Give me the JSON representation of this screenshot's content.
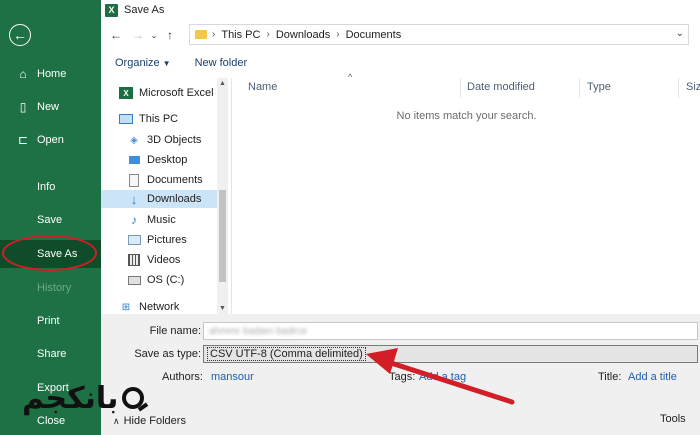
{
  "sidebar": {
    "items": [
      {
        "label": "Home",
        "icon": "home-icon",
        "glyph": "⌂"
      },
      {
        "label": "New",
        "icon": "new-document-icon",
        "glyph": "🗋"
      },
      {
        "label": "Open",
        "icon": "open-folder-icon",
        "glyph": "🗁"
      },
      {
        "label": "Info"
      },
      {
        "label": "Save"
      },
      {
        "label": "Save As"
      },
      {
        "label": "History"
      },
      {
        "label": "Print"
      },
      {
        "label": "Share"
      },
      {
        "label": "Export"
      },
      {
        "label": "Close"
      }
    ],
    "active": "Save As",
    "logo_text": "بانکجم"
  },
  "dialog": {
    "title": "Save As",
    "title_icon": "excel-icon",
    "address": {
      "crumbs": [
        "This PC",
        "Downloads",
        "Documents"
      ]
    },
    "toolbar": {
      "organize": "Organize",
      "new_folder": "New folder"
    },
    "nav_tree": [
      {
        "label": "Microsoft Excel",
        "icon": "excel-icon"
      },
      {
        "label": "This PC",
        "icon": "computer-icon"
      },
      {
        "label": "3D Objects",
        "icon": "3d-objects-icon"
      },
      {
        "label": "Desktop",
        "icon": "desktop-icon"
      },
      {
        "label": "Documents",
        "icon": "documents-icon"
      },
      {
        "label": "Downloads",
        "icon": "downloads-icon"
      },
      {
        "label": "Music",
        "icon": "music-icon"
      },
      {
        "label": "Pictures",
        "icon": "pictures-icon"
      },
      {
        "label": "Videos",
        "icon": "videos-icon"
      },
      {
        "label": "OS (C:)",
        "icon": "drive-icon"
      },
      {
        "label": "Network",
        "icon": "network-icon"
      }
    ],
    "selected_tree_item": "Downloads",
    "columns": [
      "Name",
      "Date modified",
      "Type",
      "Size"
    ],
    "empty_message": "No items match your search.",
    "form": {
      "file_name_label": "File name:",
      "file_name_value": "ahmmr badam badrce",
      "save_as_type_label": "Save as type:",
      "save_as_type_value": "CSV UTF-8 (Comma delimited)",
      "authors_label": "Authors:",
      "authors_value": "mansour",
      "tags_label": "Tags:",
      "tags_value": "Add a tag",
      "title_label": "Title:",
      "title_value": "Add a title",
      "hide_folders": "Hide Folders",
      "tools": "Tools"
    }
  },
  "colors": {
    "excel_green": "#1e7145",
    "active_green": "#0f4c2a",
    "annotation_red": "#d21e26",
    "link_blue": "#1a5fb4"
  }
}
